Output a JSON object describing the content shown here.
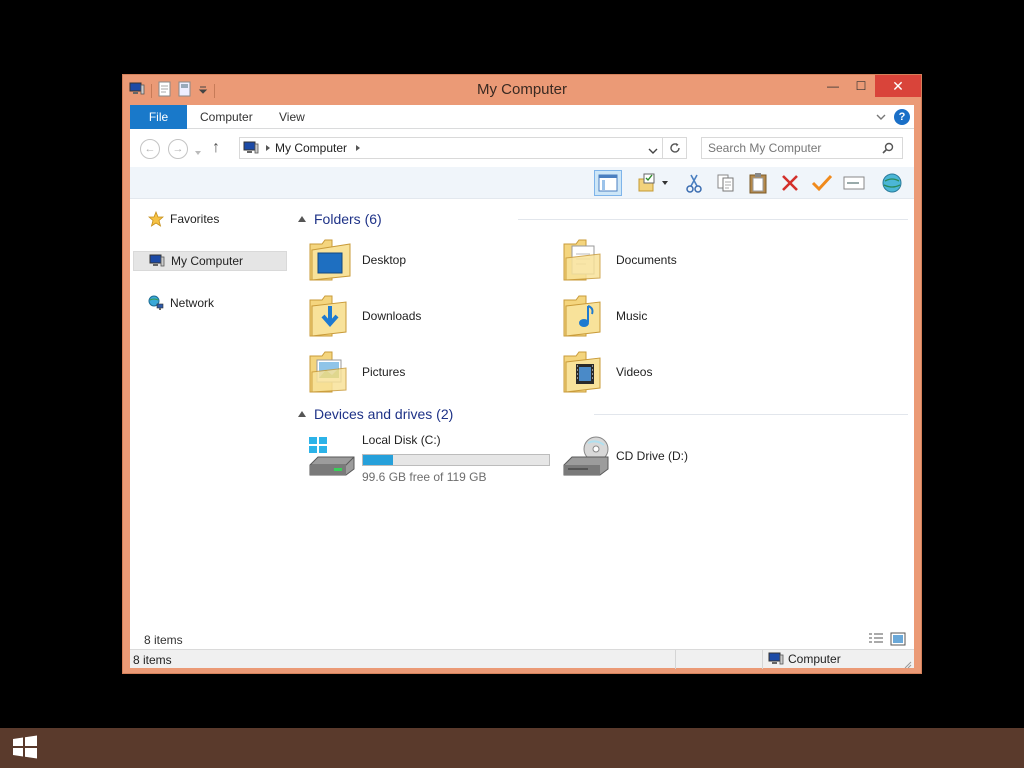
{
  "window": {
    "title": "My Computer",
    "close_symbol": "✕",
    "maximize_symbol": "☐",
    "minimize_symbol": "—"
  },
  "ribbon": {
    "tabs": [
      "File",
      "Computer",
      "View"
    ],
    "help_symbol": "?"
  },
  "navigation": {
    "back_symbol": "←",
    "forward_symbol": "→",
    "up_symbol": "↑",
    "address": "My Computer",
    "search_placeholder": "Search My Computer"
  },
  "toolbar": {
    "icons": [
      "preview-pane-icon",
      "select-folder-icon",
      "cut-icon",
      "copy-icon",
      "paste-icon",
      "delete-icon",
      "check-icon",
      "rename-icon",
      "properties-icon"
    ]
  },
  "sidebar": {
    "items": [
      {
        "label": "Favorites",
        "icon": "star-icon"
      },
      {
        "label": "My Computer",
        "icon": "computer-icon",
        "selected": true
      },
      {
        "label": "Network",
        "icon": "network-icon"
      }
    ]
  },
  "content": {
    "folders_header": "Folders (6)",
    "folders": [
      {
        "name": "Desktop",
        "icon": "desktop-folder-icon"
      },
      {
        "name": "Documents",
        "icon": "documents-folder-icon"
      },
      {
        "name": "Downloads",
        "icon": "downloads-folder-icon"
      },
      {
        "name": "Music",
        "icon": "music-folder-icon"
      },
      {
        "name": "Pictures",
        "icon": "pictures-folder-icon"
      },
      {
        "name": "Videos",
        "icon": "videos-folder-icon"
      }
    ],
    "devices_header": "Devices and drives (2)",
    "drives": [
      {
        "name": "Local Disk (C:)",
        "free_text": "99.6 GB free of 119 GB",
        "used_fraction": 0.163,
        "icon": "hard-disk-icon"
      },
      {
        "name": "CD Drive (D:)",
        "icon": "cd-drive-icon"
      }
    ]
  },
  "footer": {
    "item_count": "8 items"
  },
  "statusbar": {
    "left": "8 items",
    "right": "Computer"
  },
  "colors": {
    "titlebar": "#eb9a76",
    "file_tab": "#1979ca",
    "close_button": "#d9443a",
    "group_header": "#1e3287",
    "drive_bar": "#26a0da",
    "taskbar": "#5a3a2c"
  }
}
